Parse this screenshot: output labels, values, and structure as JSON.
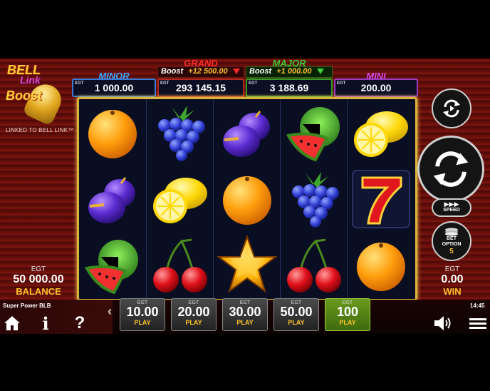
{
  "logo": {
    "word1": "BELL",
    "word2": "Link",
    "word3": "Boost",
    "linked_text": "LINKED TO BELL LINK™"
  },
  "jackpots": {
    "minor": {
      "title": "MINOR",
      "egt": "EGT",
      "value": "1 000.00"
    },
    "grand": {
      "title": "GRAND",
      "boost_label": "Boost",
      "boost_value": "+12 500.00",
      "egt": "EGT",
      "value": "293 145.15"
    },
    "major": {
      "title": "MAJOR",
      "boost_label": "Boost",
      "boost_value": "+1 000.00",
      "egt": "EGT",
      "value": "3 188.69"
    },
    "mini": {
      "title": "MINI",
      "egt": "EGT",
      "value": "200.00"
    }
  },
  "reels": [
    [
      "orange",
      "plum",
      "watermelon"
    ],
    [
      "grapes",
      "lemon",
      "cherries"
    ],
    [
      "plum",
      "orange",
      "star"
    ],
    [
      "watermelon",
      "grapes",
      "cherries"
    ],
    [
      "lemon",
      "seven",
      "orange"
    ]
  ],
  "controls": {
    "autoplay_icon": "autoplay-icon",
    "spin_icon": "spin-icon",
    "speed_label": "SPEED",
    "bet_option_label": "BET OPTION",
    "bet_option_value": "5"
  },
  "balance": {
    "currency": "EGT",
    "amount": "50 000.00",
    "label": "BALANCE"
  },
  "win": {
    "currency": "EGT",
    "amount": "0.00",
    "label": "WIN"
  },
  "footer": {
    "game_name": "Super Power BLB",
    "clock": "14:45",
    "bets": [
      {
        "egt": "EGT",
        "value": "10.00",
        "play": "PLAY"
      },
      {
        "egt": "EGT",
        "value": "20.00",
        "play": "PLAY"
      },
      {
        "egt": "EGT",
        "value": "30.00",
        "play": "PLAY"
      },
      {
        "egt": "EGT",
        "value": "50.00",
        "play": "PLAY"
      },
      {
        "egt": "EGT",
        "value": "100",
        "play": "PLAY",
        "active": true
      }
    ],
    "home_icon": "home-icon",
    "info_icon": "info-icon",
    "help_icon": "help-icon",
    "sound_icon": "sound-icon",
    "menu_icon": "menu-icon"
  },
  "colors": {
    "minor": "#3fa6ff",
    "grand": "#ff2a2a",
    "major": "#3ecf3a",
    "mini": "#d84bf0",
    "gold": "#ffc32b"
  }
}
